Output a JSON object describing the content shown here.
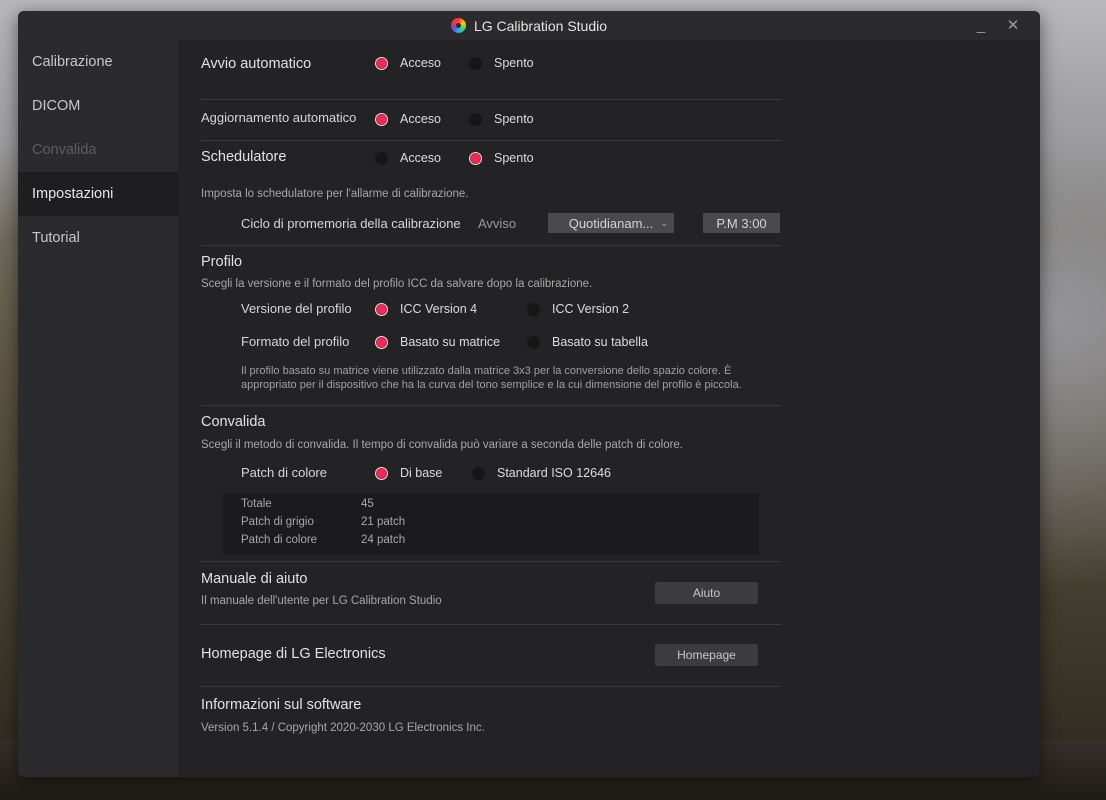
{
  "window": {
    "title": "LG Calibration Studio",
    "minimize_glyph": "_",
    "close_glyph": "✕"
  },
  "sidebar": {
    "items": [
      {
        "label": "Calibrazione",
        "state": "normal"
      },
      {
        "label": "DICOM",
        "state": "normal"
      },
      {
        "label": "Convalida",
        "state": "disabled"
      },
      {
        "label": "Impostazioni",
        "state": "active"
      },
      {
        "label": "Tutorial",
        "state": "normal"
      }
    ]
  },
  "settings": {
    "auto_start": {
      "label": "Avvio automatico",
      "on": "Acceso",
      "off": "Spento",
      "selected": "on"
    },
    "auto_update": {
      "label": "Aggiornamento automatico",
      "on": "Acceso",
      "off": "Spento",
      "selected": "on"
    },
    "scheduler": {
      "label": "Schedulatore",
      "on": "Acceso",
      "off": "Spento",
      "selected": "off",
      "description": "Imposta lo schedulatore per l'allarme di calibrazione.",
      "cycle_label": "Ciclo di promemoria della calibrazione",
      "notice_label": "Avviso",
      "frequency": "Quotidianam...",
      "time": "P.M 3:00"
    },
    "profile": {
      "title": "Profilo",
      "description": "Scegli la versione e il formato del profilo ICC da salvare dopo la calibrazione.",
      "version_label": "Versione del profilo",
      "version_options": [
        "ICC Version 4",
        "ICC Version 2"
      ],
      "version_selected": 0,
      "format_label": "Formato del profilo",
      "format_options": [
        "Basato su matrice",
        "Basato su tabella"
      ],
      "format_selected": 0,
      "note_line1": "Il profilo basato su matrice viene utilizzato dalla matrice 3x3 per la conversione dello spazio colore. È",
      "note_line2": "appropriato per il dispositivo che ha la curva del tono semplice e la cui dimensione del profilo è piccola."
    },
    "validation": {
      "title": "Convalida",
      "description": "Scegli il metodo di convalida. Il tempo di convalida può variare a seconda delle patch di colore.",
      "patch_label": "Patch di colore",
      "patch_options": [
        "Di base",
        "Standard ISO 12646"
      ],
      "patch_selected": 0,
      "rows": [
        {
          "label": "Totale",
          "value": "45"
        },
        {
          "label": "Patch di grigio",
          "value": "21 patch"
        },
        {
          "label": "Patch di colore",
          "value": "24 patch"
        }
      ]
    },
    "help": {
      "title": "Manuale di aiuto",
      "description": "Il manuale dell'utente per LG Calibration Studio",
      "button": "Aiuto"
    },
    "homepage": {
      "title": "Homepage di LG Electronics",
      "button": "Homepage"
    },
    "about": {
      "title": "Informazioni sul software",
      "version": "Version 5.1.4 / Copyright 2020-2030 LG Electronics Inc."
    }
  },
  "colors": {
    "accent": "#e52f5a",
    "window_bg": "#232325",
    "sidebar_bg": "#2b2b2d"
  }
}
